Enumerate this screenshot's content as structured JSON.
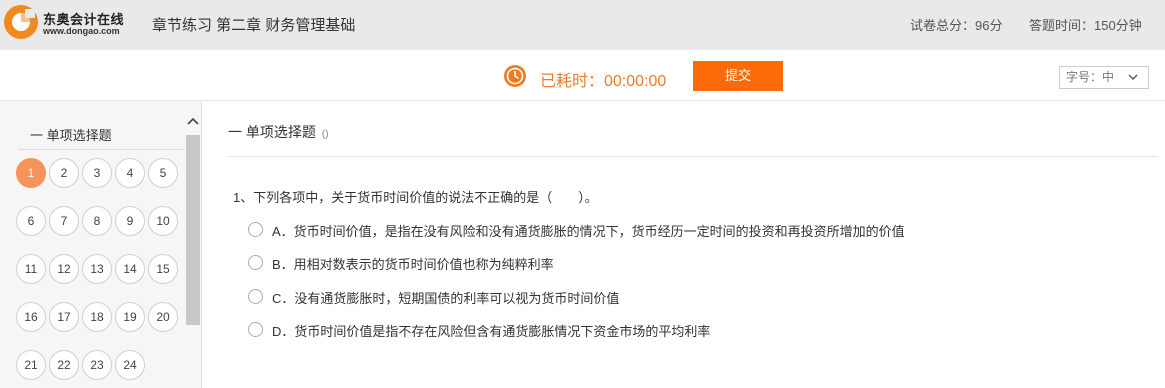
{
  "header": {
    "logo_text": "东奥会计在线",
    "logo_url": "www.dongao.com",
    "title": "章节练习 第二章 财务管理基础",
    "total_score": "试卷总分：96分",
    "answer_time": "答题时间：150分钟"
  },
  "toolbar": {
    "elapsed": "已耗时：00:00:00",
    "submit_label": "提交",
    "font_size_select": "字号：中"
  },
  "sidebar": {
    "section_title": "一 单项选择题",
    "numbers": [
      "1",
      "2",
      "3",
      "4",
      "5",
      "6",
      "7",
      "8",
      "9",
      "10",
      "11",
      "12",
      "13",
      "14",
      "15",
      "16",
      "17",
      "18",
      "19",
      "20",
      "21",
      "22",
      "23",
      "24"
    ],
    "current": "1"
  },
  "main": {
    "section_title": "一 单项选择题",
    "section_note": "()",
    "question": "1、下列各项中，关于货币时间价值的说法不正确的是（　　）。",
    "options": [
      "A．货币时间价值，是指在没有风险和没有通货膨胀的情况下，货币经历一定时间的投资和再投资所增加的价值",
      "B．用相对数表示的货币时间价值也称为纯粹利率",
      "C．没有通货膨胀时，短期国债的利率可以视为货币时间价值",
      "D．货币时间价值是指不存在风险但含有通货膨胀情况下资金市场的平均利率"
    ]
  },
  "colors": {
    "accent": "#fd6a0a",
    "timer": "#ee7b27",
    "active_number": "#f4935a",
    "header_bg": "#e9e9e9"
  }
}
